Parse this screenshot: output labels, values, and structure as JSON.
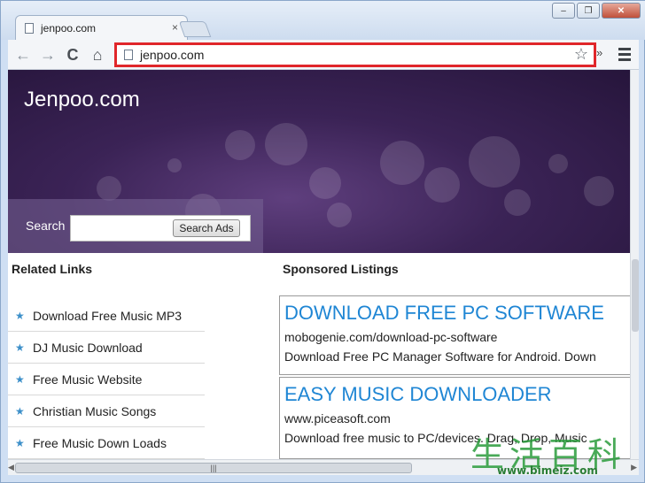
{
  "browser": {
    "tab_title": "jenpoo.com",
    "tab_close": "×",
    "address": "jenpoo.com",
    "star_glyph": "☆",
    "ext_chevron": "»",
    "win_min": "–",
    "win_max": "❐",
    "win_close": "✕",
    "nav": {
      "back": "←",
      "forward": "→",
      "reload": "C",
      "home": "⌂"
    }
  },
  "page": {
    "site_title": "Jenpoo.com",
    "search": {
      "label": "Search",
      "placeholder": "",
      "button": "Search Ads"
    },
    "related_links": {
      "heading": "Related Links",
      "star_glyph": "★",
      "items": [
        {
          "label": "Download Free Music MP3"
        },
        {
          "label": "DJ Music Download"
        },
        {
          "label": "Free Music Website"
        },
        {
          "label": "Christian Music Songs"
        },
        {
          "label": "Free Music Down Loads"
        }
      ]
    },
    "sponsored": {
      "heading": "Sponsored Listings",
      "listings": [
        {
          "title": "DOWNLOAD FREE PC SOFTWARE",
          "url": "mobogenie.com/download-pc-software",
          "desc": "Download Free PC Manager Software for Android. Down"
        },
        {
          "title": "EASY MUSIC DOWNLOADER",
          "url": "www.piceasoft.com",
          "desc": "Download free music to PC/devices. Drag, Drop, Music"
        }
      ]
    }
  },
  "scrollbar": {
    "grip": "|||"
  },
  "watermark": {
    "cjk": "生活百科",
    "url": "www.bimeiz.com"
  },
  "colors": {
    "highlight_border": "#e0262a",
    "link_blue": "#1f86d4",
    "hero_purple": "#3b2356"
  }
}
